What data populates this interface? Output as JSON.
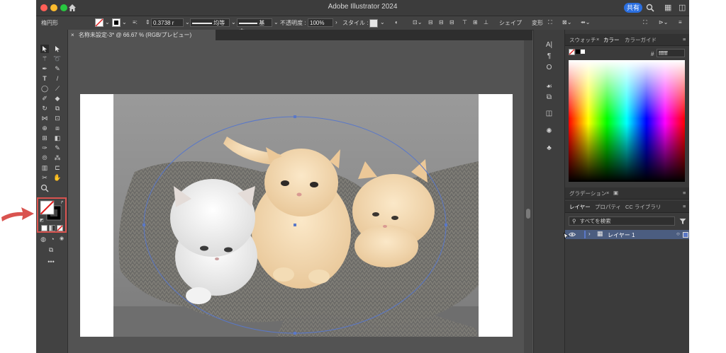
{
  "window": {
    "title": "Adobe Illustrator 2024",
    "share_label": "共有"
  },
  "control_bar": {
    "object_type": "楕円形",
    "stroke_weight": "0.3738 r",
    "stroke_profile": "均等",
    "brush": "基本",
    "opacity_label": "不透明度 :",
    "opacity_value": "100%",
    "style_label": "スタイル :",
    "shape_label": "シェイプ",
    "transform_label": "変形"
  },
  "document_tab": {
    "close": "×",
    "title": "名称未設定-3* @ 66.67 % (RGB/プレビュー)"
  },
  "right_panel": {
    "tabs_top": [
      "スウォッチ",
      "カラー",
      "カラーガイド"
    ],
    "hex_prefix": "#",
    "hex_value": "ffffff",
    "gradient_tab": "グラデーション",
    "tabs_layers": [
      "レイヤー",
      "プロパティ",
      "CC ライブラリ"
    ],
    "search_placeholder": "すべてを検索",
    "layer_name": "レイヤー 1"
  },
  "colors": {
    "highlight": "#d9534f",
    "selection": "#5a78c8",
    "share": "#2b6fe0"
  },
  "icons": [
    "home-icon",
    "search-icon",
    "selection-tool-icon",
    "direct-selection-tool-icon",
    "pen-tool-icon",
    "type-tool-icon",
    "line-tool-icon",
    "ellipse-tool-icon",
    "brush-tool-icon",
    "zoom-tool-icon",
    "hand-tool-icon",
    "fill-stroke-widget",
    "eye-icon",
    "filter-icon",
    "arrow-pointer-icon"
  ]
}
